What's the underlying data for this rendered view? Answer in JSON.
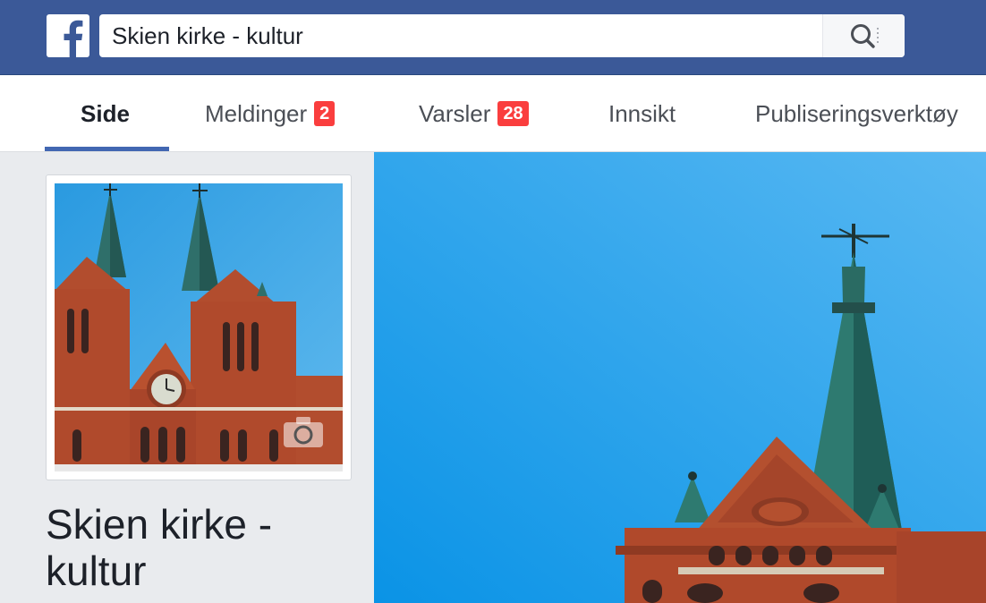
{
  "header": {
    "logo_icon": "facebook-logo-icon",
    "search": {
      "value": "Skien kirke - kultur",
      "icon": "search-icon"
    }
  },
  "tabs": [
    {
      "label": "Side",
      "active": true
    },
    {
      "label": "Meldinger",
      "badge": "2"
    },
    {
      "label": "Varsler",
      "badge": "28"
    },
    {
      "label": "Innsikt"
    },
    {
      "label": "Publiseringsverktøy"
    }
  ],
  "page": {
    "name": "Skien kirke - kultur",
    "profile_photo_icon": "camera-icon"
  },
  "colors": {
    "brand": "#3b5998",
    "active_tab": "#4267b2",
    "badge": "#fa3e3e",
    "sky": "#1ea6ef"
  }
}
